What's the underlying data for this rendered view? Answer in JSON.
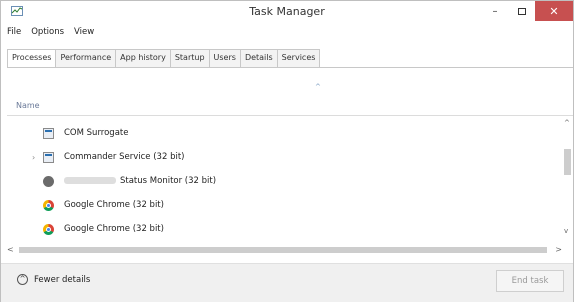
{
  "window": {
    "title": "Task Manager",
    "controls": {
      "minimize": "–",
      "maximize": "□",
      "close": "✕"
    }
  },
  "menu": [
    "File",
    "Options",
    "View"
  ],
  "tabs": [
    "Processes",
    "Performance",
    "App history",
    "Startup",
    "Users",
    "Details",
    "Services"
  ],
  "active_tab": "Processes",
  "columns": {
    "name": "Name"
  },
  "sort_indicator": "^",
  "rows": [
    {
      "name": "COM Surrogate",
      "icon": "exe-icon",
      "expandable": false
    },
    {
      "name": "Commander Service (32 bit)",
      "icon": "exe-icon",
      "expandable": true,
      "expander": "›"
    },
    {
      "name": "Status Monitor (32 bit)",
      "icon": "monitor-icon",
      "expandable": false,
      "redacted_prefix": true
    },
    {
      "name": "Google Chrome (32 bit)",
      "icon": "chrome-icon",
      "expandable": false
    },
    {
      "name": "Google Chrome (32 bit)",
      "icon": "chrome-icon",
      "expandable": false
    }
  ],
  "scroll": {
    "up": "^",
    "down": "v",
    "left": "<",
    "right": ">"
  },
  "footer": {
    "fewer_details": "Fewer details",
    "fewer_icon": "^",
    "end_task": "End task"
  }
}
